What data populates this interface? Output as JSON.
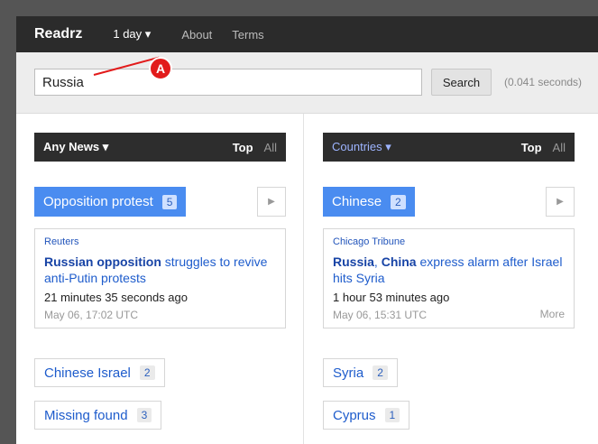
{
  "topbar": {
    "brand": "Readrz",
    "period": "1 day ▾",
    "about": "About",
    "terms": "Terms"
  },
  "search": {
    "query": "Russia",
    "button": "Search",
    "timing": "(0.041 seconds)"
  },
  "annotation": {
    "label": "A"
  },
  "left": {
    "header": {
      "title": "Any News ▾",
      "top": "Top",
      "all": "All"
    },
    "topic": {
      "label": "Opposition protest",
      "count": "5",
      "play": "▶"
    },
    "card": {
      "source": "Reuters",
      "headline_bold": "Russian opposition",
      "headline_rest": " struggles to revive anti-Putin protests",
      "ago": "21 minutes 35 seconds ago",
      "date": "May 06, 17:02 UTC"
    },
    "chips": [
      {
        "label": "Chinese Israel",
        "count": "2"
      },
      {
        "label": "Missing found",
        "count": "3"
      }
    ]
  },
  "right": {
    "header": {
      "title": "Countries ▾",
      "top": "Top",
      "all": "All"
    },
    "topic": {
      "label": "Chinese",
      "count": "2",
      "play": "▶"
    },
    "card": {
      "source": "Chicago Tribune",
      "headline_bold1": "Russia",
      "headline_sep": ", ",
      "headline_bold2": "China",
      "headline_rest": " express alarm after Israel hits Syria",
      "ago": "1 hour 53 minutes ago",
      "date": "May 06, 15:31 UTC",
      "more": "More"
    },
    "chips": [
      {
        "label": "Syria",
        "count": "2"
      },
      {
        "label": "Cyprus",
        "count": "1"
      }
    ]
  },
  "colors": {
    "accent": "#4a8cf0",
    "topbar": "#2b2b2b",
    "annotation": "#e21b1b"
  }
}
